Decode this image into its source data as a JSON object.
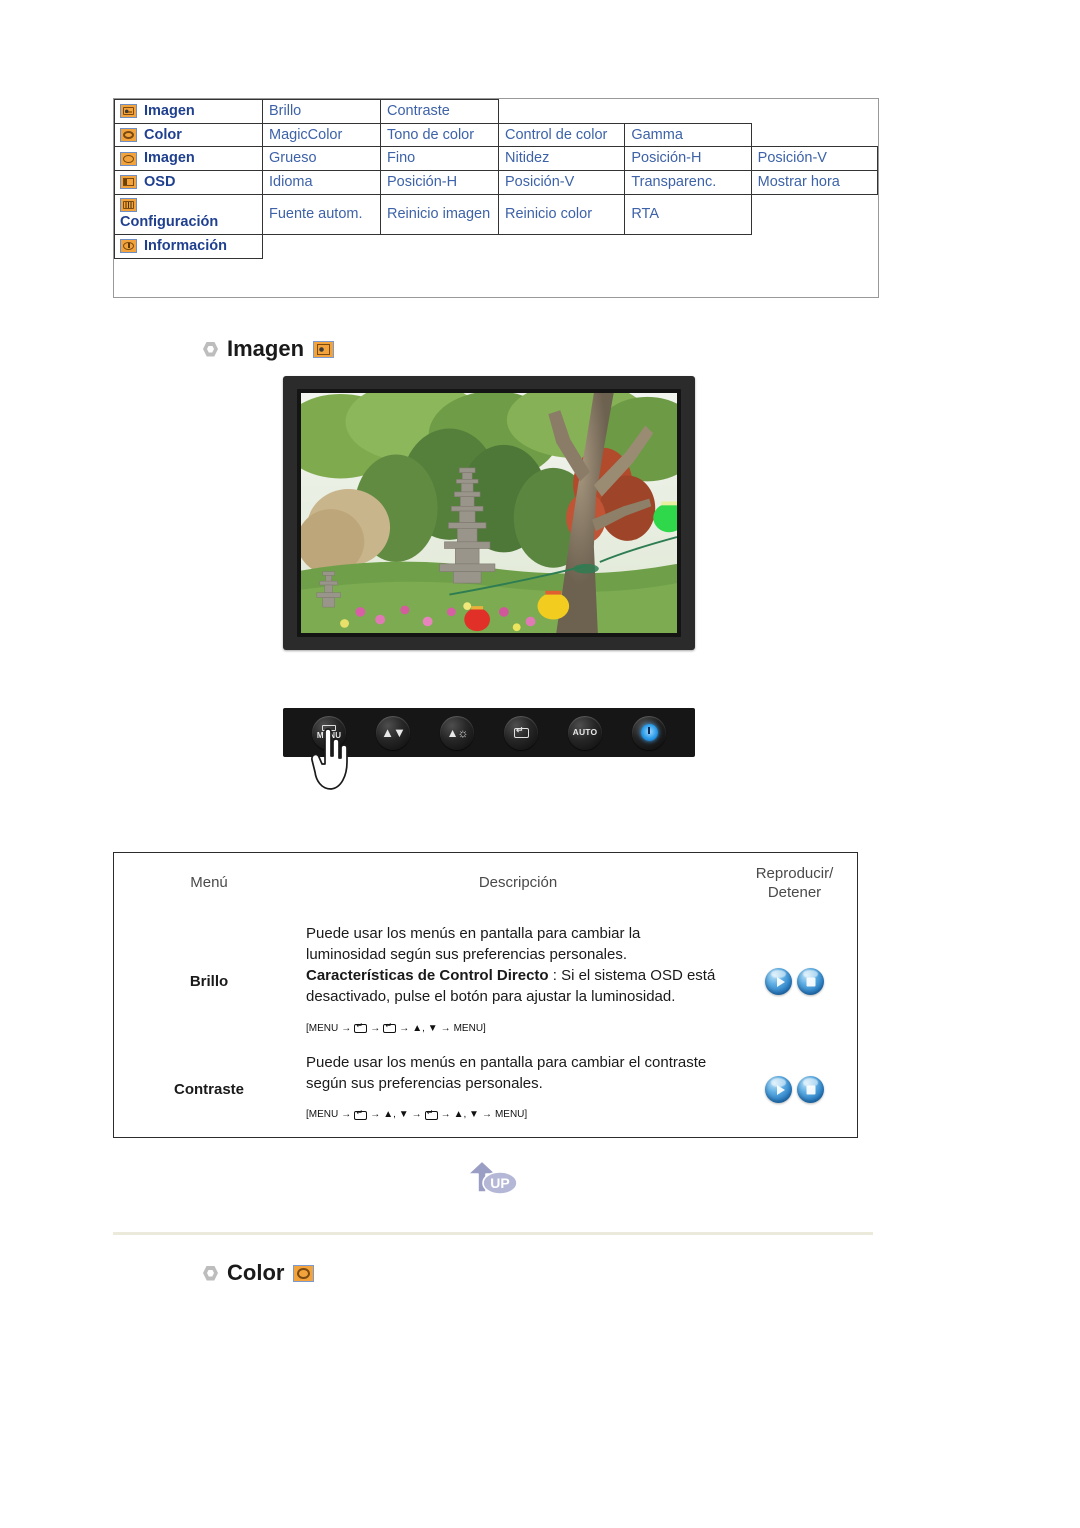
{
  "menu_map": {
    "rows": [
      {
        "category": "Imagen",
        "icon": "picture-icon",
        "items": [
          "Brillo",
          "Contraste"
        ]
      },
      {
        "category": "Color",
        "icon": "palette-icon",
        "items": [
          "MagicColor",
          "Tono de color",
          "Control de color",
          "Gamma"
        ]
      },
      {
        "category": "Imagen",
        "icon": "geometry-icon",
        "items": [
          "Grueso",
          "Fino",
          "Nitidez",
          "Posición-H",
          "Posición-V"
        ]
      },
      {
        "category": "OSD",
        "icon": "osd-icon",
        "items": [
          "Idioma",
          "Posición-H",
          "Posición-V",
          "Transparenc.",
          "Mostrar hora"
        ]
      },
      {
        "category": "Configuración",
        "icon": "setup-icon",
        "items": [
          "Fuente autom.",
          "Reinicio imagen",
          "Reinicio color",
          "RTA"
        ]
      },
      {
        "category": "Información",
        "icon": "info-icon",
        "items": []
      }
    ]
  },
  "sections": {
    "imagen": {
      "title": "Imagen",
      "icon": "picture-icon"
    },
    "color": {
      "title": "Color",
      "icon": "palette-icon"
    }
  },
  "monitor": {
    "screen_alt": "Jardín con pagoda de piedra, árboles y faroles de colores"
  },
  "control_bar": {
    "buttons": [
      {
        "name": "menu-button",
        "label": "MENU",
        "icon": "menu-icon"
      },
      {
        "name": "down-button",
        "label": "",
        "icon": "arrow-down-icon"
      },
      {
        "name": "brightness-button",
        "label": "",
        "icon": "brightness-icon"
      },
      {
        "name": "enter-button",
        "label": "",
        "icon": "enter-icon"
      },
      {
        "name": "auto-button",
        "label": "AUTO",
        "icon": "auto-icon"
      },
      {
        "name": "power-button",
        "label": "",
        "icon": "power-icon"
      }
    ]
  },
  "desc_table": {
    "headers": {
      "menu": "Menú",
      "description": "Descripción",
      "play_stop_line1": "Reproducir/",
      "play_stop_line2": "Detener"
    },
    "rows": [
      {
        "menu": "Brillo",
        "desc_part1": "Puede usar los menús en pantalla para cambiar la luminosidad según sus preferencias personales. ",
        "desc_bold": "Características de Control Directo",
        "desc_part2": " : Si el sistema OSD está desactivado, pulse el botón para ajustar la luminosidad.",
        "keyseq": [
          "[MENU",
          "→",
          "KEY",
          "→",
          "KEY",
          "→",
          "▲, ▼",
          "→",
          "MENU]"
        ],
        "play_label": "Reproducir",
        "stop_label": "Detener"
      },
      {
        "menu": "Contraste",
        "desc_part1": "Puede usar los menús en pantalla para cambiar el contraste según sus preferencias personales.",
        "desc_bold": "",
        "desc_part2": "",
        "keyseq": [
          "[MENU",
          "→",
          "KEY",
          "→",
          "▲, ▼",
          "→",
          "KEY",
          "→",
          "▲, ▼",
          "→",
          "MENU]"
        ],
        "play_label": "Reproducir",
        "stop_label": "Detener"
      }
    ]
  },
  "up_button": {
    "label": "UP",
    "icon": "arrow-up-icon"
  },
  "colors": {
    "menu_text": "#3d62a8",
    "category_text": "#1f3f8f",
    "icon_orange": "#f2a33c",
    "icon_border": "#6f8fc4",
    "orb_blue": "#2b7fc4",
    "divider": "#eceadb",
    "header_text": "#4a4a4a"
  }
}
